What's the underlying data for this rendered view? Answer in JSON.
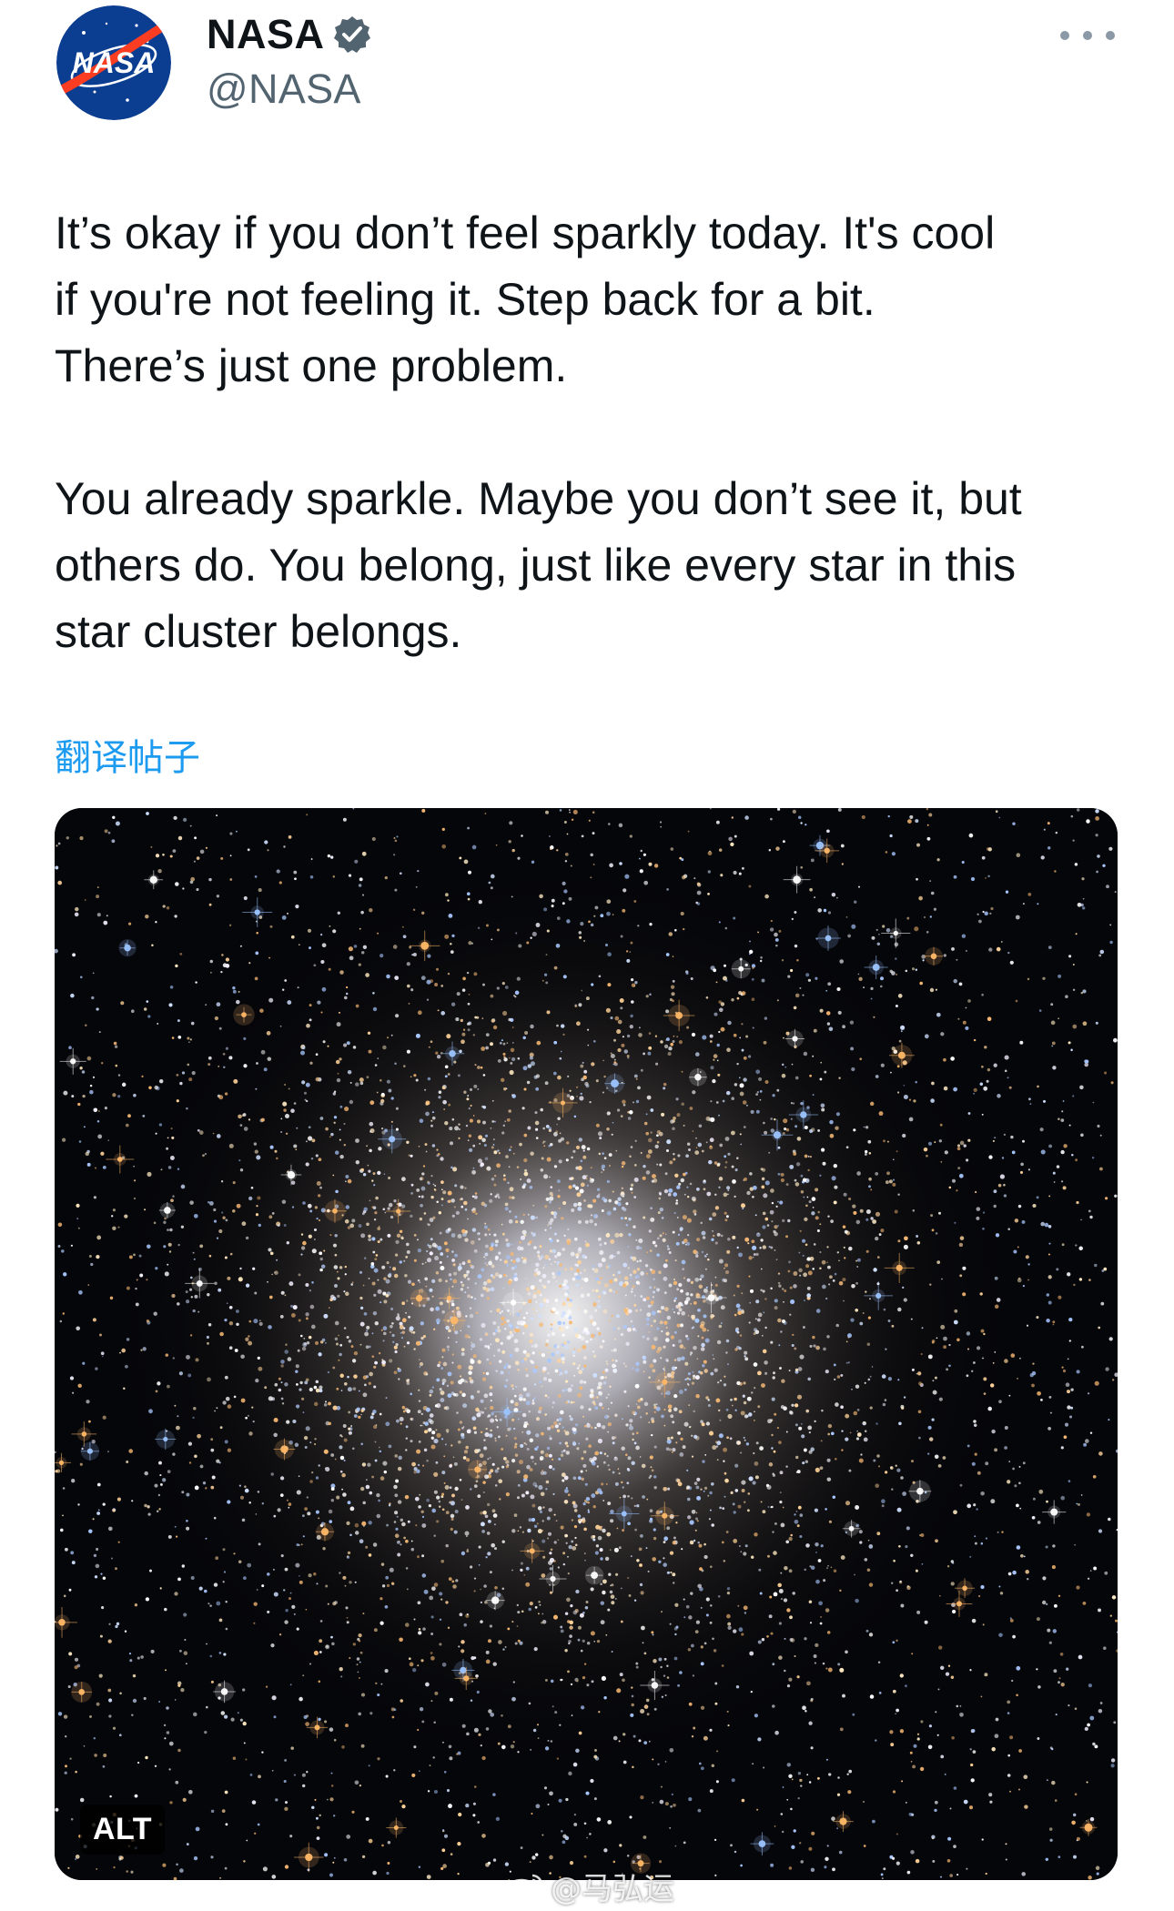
{
  "author": {
    "display_name": "NASA",
    "handle": "@NASA",
    "avatar_icon": "nasa-meatball-logo",
    "avatar_text": "NASA",
    "verified_icon": "verified-badge-icon",
    "verified_color": "#536471"
  },
  "menu": {
    "icon": "more-horizontal-icon"
  },
  "post": {
    "paragraphs": [
      "It’s okay if you don’t feel sparkly today. It's cool\nif you're not feeling it. Step back for a bit.\nThere’s just one problem.",
      "You already sparkle. Maybe you don’t see it, but\nothers do. You belong, just like every star in this\nstar cluster belongs."
    ],
    "translate_label": "翻译帖子"
  },
  "media": {
    "alt_label": "ALT"
  },
  "watermark": {
    "icon": "weibo-icon",
    "text": "@马弘运"
  },
  "colors": {
    "text_primary": "#0f1419",
    "text_secondary": "#536471",
    "link": "#1d9bf0",
    "nasa_blue": "#0b3d91",
    "nasa_red": "#fc3d21"
  }
}
